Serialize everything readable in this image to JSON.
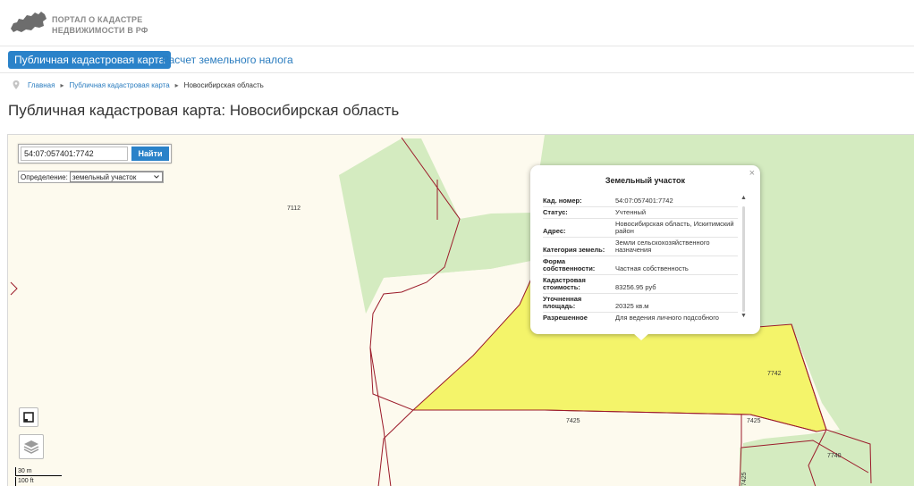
{
  "header": {
    "logo_line1": "ПОРТАЛ О КАДАСТРЕ",
    "logo_line2": "НЕДВИЖИМОСТИ В РФ"
  },
  "tabs": [
    {
      "label": "Публичная кадастровая карта",
      "active": true
    },
    {
      "label": "Расчет земельного налога",
      "active": false
    }
  ],
  "breadcrumb": {
    "home": "Главная",
    "map": "Публичная кадастровая карта",
    "current": "Новосибирская область",
    "separator": "▸"
  },
  "page_title": "Публичная кадастровая карта: Новосибирская область",
  "search": {
    "value": "54:07:057401:7742",
    "button": "Найти",
    "definition_label": "Определение:",
    "definition_value": "земельный участок"
  },
  "map_labels": {
    "l7112": "7112",
    "l7742": "7742",
    "l7425a": "7425",
    "l7425b": "7425",
    "l7740": "7740",
    "l7425c": "7425"
  },
  "popup": {
    "title": "Земельный участок",
    "close": "×",
    "rows": [
      {
        "key": "Кад. номер:",
        "value": "54:07:057401:7742"
      },
      {
        "key": "Статус:",
        "value": "Учтенный"
      },
      {
        "key": "Адрес:",
        "value": "Новосибирская область, Искитимский район"
      },
      {
        "key": "Категория земель:",
        "value": "Земли сельскохозяйственного назначения"
      },
      {
        "key": "Форма собственности:",
        "value": "Частная собственность"
      },
      {
        "key": "Кадастровая стоимость:",
        "value": "83256.95 руб"
      },
      {
        "key": "Уточненная площадь:",
        "value": "20325 кв.м"
      },
      {
        "key": "Разрешенное",
        "value": "Для ведения личного подсобного"
      }
    ]
  },
  "scale": {
    "metric": "30 m",
    "imperial": "100 ft"
  },
  "colors": {
    "accent": "#2a82c9",
    "parcel_selected": "#f4f46a",
    "forest": "#d4ebc0",
    "boundary": "#9b1b2a",
    "background": "#fdfaee"
  }
}
